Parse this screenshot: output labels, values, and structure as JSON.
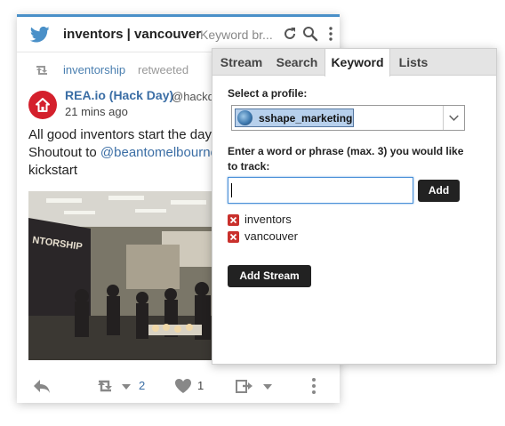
{
  "stream": {
    "title": "inventors | vancouver",
    "subtitle": "Keyword br...",
    "retweet": {
      "user": "inventorship",
      "suffix": "retweeted"
    },
    "tweet": {
      "author": "REA.io (Hack Day)",
      "handle": "@hackd",
      "time": "21 mins ago",
      "text_line1": "All good inventors start the day",
      "text_line2_prefix": "Shoutout to ",
      "text_line2_mention": "@beantomelbourne",
      "text_line3": "kickstart"
    },
    "actions": {
      "retweet_count": "2",
      "like_count": "1"
    }
  },
  "popup": {
    "tabs": [
      {
        "label": "Stream"
      },
      {
        "label": "Search"
      },
      {
        "label": "Keyword"
      },
      {
        "label": "Lists"
      }
    ],
    "active_tab": "Keyword",
    "profile_label": "Select a profile:",
    "selected_profile": "sshape_marketing",
    "phrase_label_line1": "Enter a word or phrase (max. 3) you would like",
    "phrase_label_line2": "to track:",
    "input_value": "",
    "add_label": "Add",
    "keywords": [
      {
        "label": "inventors"
      },
      {
        "label": "vancouver"
      }
    ],
    "add_stream_label": "Add Stream"
  },
  "colors": {
    "accent": "#4a90c8",
    "link": "#3b6ea5",
    "avatar_red": "#d4202c",
    "remove_red": "#c9302c",
    "chip_blue": "#b7d0ec"
  },
  "icons": [
    "twitter-bird-icon",
    "refresh-icon",
    "search-icon",
    "more-vertical-icon",
    "retweet-icon",
    "reply-icon",
    "chevron-down-icon",
    "heart-icon",
    "share-icon",
    "home-icon",
    "remove-icon"
  ]
}
